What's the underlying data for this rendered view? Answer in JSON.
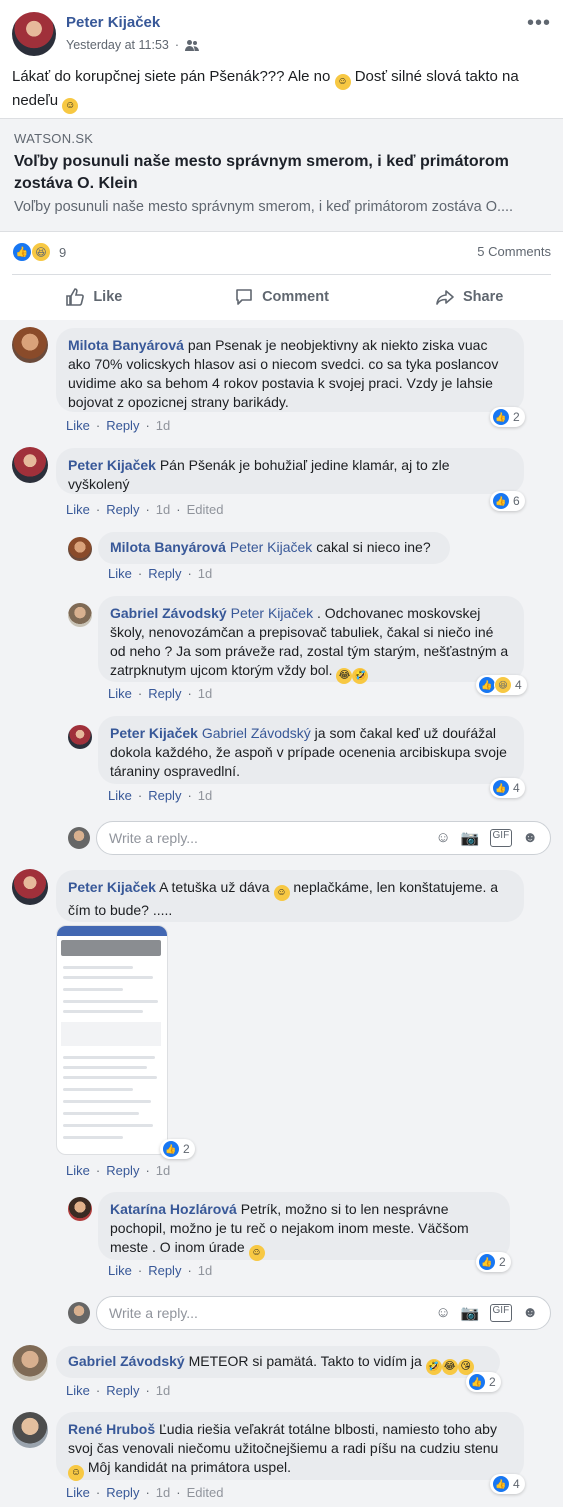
{
  "post": {
    "author": "Peter Kijaček",
    "time": "Yesterday at 11:53",
    "text_part1": "Lákať do korupčnej siete pán Pšenák??? Ale no",
    "text_part2": "Dosť silné slová takto na nedeľu",
    "link": {
      "domain": "WATSON.SK",
      "title": "Voľby posunuli naše mesto správnym smerom, i keď primátorom zostáva O. Klein",
      "description": "Voľby posunuli naše mesto správnym smerom, i keď primátorom zostáva O...."
    },
    "reaction_count": "9",
    "comments_count": "5 Comments",
    "actions": {
      "like": "Like",
      "comment": "Comment",
      "share": "Share"
    }
  },
  "labels": {
    "like": "Like",
    "reply": "Reply",
    "edited": "Edited",
    "write_reply": "Write a reply..."
  },
  "comments": [
    {
      "name": "Milota Banyárová",
      "text": "pan Psenak je neobjektivny ak niekto ziska vuac ako 70% volicskych hlasov asi o niecom svedci. co sa tyka poslancov uvidime ako sa behom 4 rokov postavia k svojej praci. Vzdy je lahsie bojovat z opozicnej strany barikády.",
      "time": "1d",
      "reactions": "2"
    },
    {
      "name": "Peter Kijaček",
      "text": "Pán Pšenák je bohužiaľ jedine klamár, aj to zle vyškolený",
      "time": "1d",
      "reactions": "6"
    },
    {
      "name": "Milota Banyárová",
      "tag": "Peter Kijaček",
      "text": "cakal si nieco ine?",
      "time": "1d"
    },
    {
      "name": "Gabriel Závodský",
      "tag": "Peter Kijaček",
      "text": ". Odchovanec moskovskej školy, nenovozámčan a prepisovač tabuliek, čakal si niečo iné od neho ? Ja som práveže rad, zostal tým starým, nešťastným a zatrpknutym ujcom ktorým vždy bol.",
      "time": "1d",
      "reactions": "4"
    },
    {
      "name": "Peter Kijaček",
      "tag": "Gabriel Závodský",
      "text": "ja som čakal keď už douŕážal dokola každého, že aspoň v prípade ocenenia arcibiskupa svoje táraniny ospravedlní.",
      "time": "1d",
      "reactions": "4"
    },
    {
      "name": "Peter Kijaček",
      "text_part1": "A tetuška už dáva",
      "text_part2": "neplačkáme, len konštatujeme. a čím to bude? .....",
      "time": "1d",
      "reactions": "2"
    },
    {
      "name": "Katarína Hozlárová",
      "text": "Petrík, možno si to len nesprávne pochopil, možno je tu reč o nejakom inom meste. Väčšom meste . O inom úrade",
      "time": "1d",
      "reactions": "2"
    },
    {
      "name": "Gabriel Závodský",
      "text": "METEOR si pamätá. Takto to vidím ja",
      "time": "1d",
      "reactions": "2"
    },
    {
      "name": "René Hruboš",
      "text": "Ľudia riešia veľakrát totálne blbosti, namiesto toho aby svoj čas venovali niečomu užitočnejšiemu a radi píšu na cudziu stenu",
      "text2": "Môj kandidát na primátora uspel.",
      "time": "1d",
      "reactions": "4"
    }
  ],
  "colors": {
    "link": "#385898",
    "like_blue": "#1877f2",
    "bubble": "#e9ebee"
  }
}
